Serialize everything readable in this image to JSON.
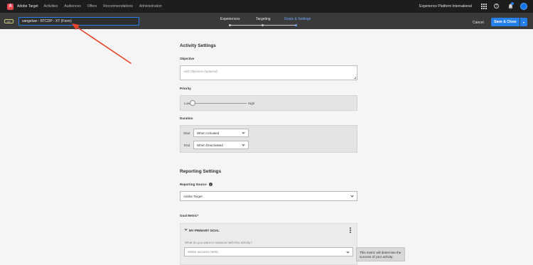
{
  "topnav": {
    "brand": "Adobe Target",
    "items": [
      {
        "label": "Activities",
        "active": true
      },
      {
        "label": "Audiences",
        "active": false
      },
      {
        "label": "Offers",
        "active": false
      },
      {
        "label": "Recommendations",
        "active": false
      },
      {
        "label": "Administration",
        "active": false
      }
    ],
    "org_name": "Experience Platform International",
    "icons": [
      "apps-grid-icon",
      "help-icon",
      "notifications-bell-icon",
      "user-avatar"
    ]
  },
  "activity_bar": {
    "type_badge": "XT",
    "activity_name": "vangeluw - RTCDP - XT (Form)",
    "steps": [
      {
        "label": "Experiences",
        "active": false
      },
      {
        "label": "Targeting",
        "active": false
      },
      {
        "label": "Goals & Settings",
        "active": true
      }
    ],
    "cancel_label": "Cancel",
    "save_label": "Save & Close",
    "save_menu_icon": "chevron-down-icon"
  },
  "activity_settings": {
    "heading": "Activity Settings",
    "objective_label": "Objective",
    "objective_placeholder": "Add Objective (optional)",
    "priority_label": "Priority",
    "priority_low": "Low",
    "priority_high": "High",
    "priority_level": 0,
    "duration_label": "Duration",
    "start_label": "Start",
    "start_value": "When Activated",
    "end_label": "End",
    "end_value": "When Deactivated"
  },
  "reporting_settings": {
    "heading": "Reporting Settings",
    "reporting_source_label": "Reporting Source",
    "reporting_source_value": "Adobe Target",
    "goal_metric_label": "Goal Metric*",
    "primary_goal_title": "MY PRIMARY GOAL",
    "goal_question": "What do you want to measure with this activity?",
    "success_metric_placeholder": "Select success metric",
    "tooltip": "This metric will determine the success of your activity."
  },
  "annotation": {
    "color": "#e8432c"
  }
}
